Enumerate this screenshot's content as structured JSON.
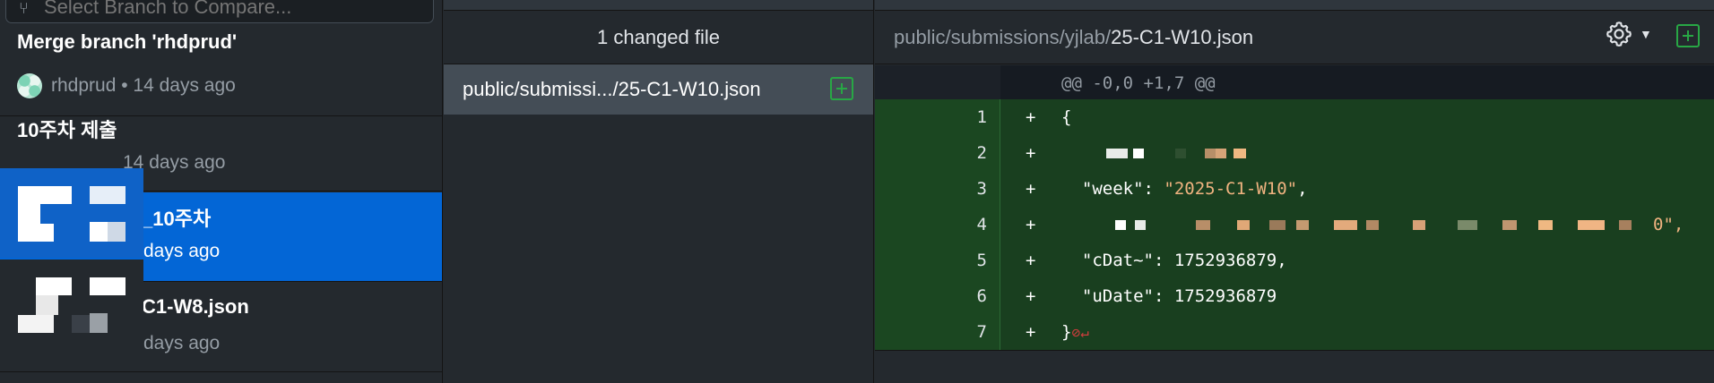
{
  "search": {
    "placeholder": "Select Branch to Compare..."
  },
  "history": {
    "commits": [
      {
        "title": "Merge branch 'rhdprud'",
        "author": "rhdprud",
        "time": "14 days ago"
      },
      {
        "title": "10주차 제출",
        "author": "",
        "time": "14 days ago"
      },
      {
        "title": "_10주차",
        "author": "",
        "time": "days ago"
      },
      {
        "title": "C1-W8.json",
        "author": "",
        "time": "days ago"
      }
    ]
  },
  "files": {
    "header": "1 changed file",
    "items": [
      {
        "name": "public/submissi.../25-C1-W10.json"
      }
    ]
  },
  "diff": {
    "path_dir": "public/submissions/yjlab/",
    "path_file": "25-C1-W10.json",
    "hunk": "@@ -0,0 +1,7 @@",
    "lines": [
      {
        "num": "1",
        "sign": "+",
        "code": "{"
      },
      {
        "num": "2",
        "sign": "+",
        "code": ""
      },
      {
        "num": "3",
        "sign": "+",
        "key": "  \"week\": ",
        "value": "\"2025-C1-W10\"",
        "rest": ","
      },
      {
        "num": "4",
        "sign": "+",
        "code": "",
        "tail": "0\","
      },
      {
        "num": "5",
        "sign": "+",
        "code": "  \"cDat~\": 1752936879,"
      },
      {
        "num": "6",
        "sign": "+",
        "code": "  \"uDate\": 1752936879"
      },
      {
        "num": "7",
        "sign": "+",
        "code": "}",
        "no_eol_marker": "⊘↵"
      }
    ]
  },
  "icons": {
    "settings": "gear-icon",
    "add": "plus-square-icon",
    "caret": "caret-down-icon"
  },
  "colors": {
    "accent": "#0366d6",
    "added_bg": "#193f1f",
    "string": "#f0b380",
    "add_icon": "#28a745"
  }
}
